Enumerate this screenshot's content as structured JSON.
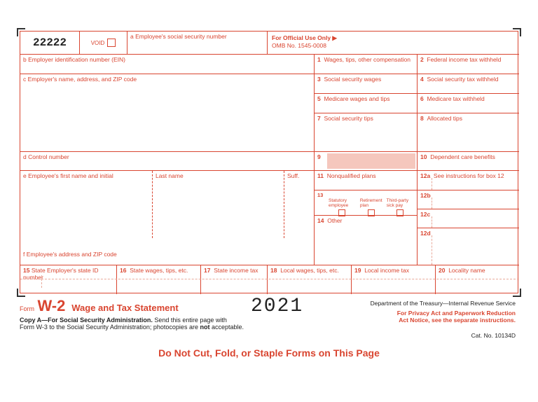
{
  "form_number": "22222",
  "void_label": "VOID",
  "box_a": "a  Employee's social security number",
  "omb_title": "For Official Use Only ▶",
  "omb_number": "OMB No. 1545-0008",
  "box_b": "b  Employer identification number (EIN)",
  "box_c": "c  Employer's name, address, and ZIP code",
  "box_d": "d  Control number",
  "box_e": "e  Employee's first name and initial",
  "box_e_last": "Last name",
  "box_e_suff": "Suff.",
  "box_f": "f  Employee's address and ZIP code",
  "boxes": {
    "1": "Wages, tips, other compensation",
    "2": "Federal income tax withheld",
    "3": "Social security wages",
    "4": "Social security tax withheld",
    "5": "Medicare wages and tips",
    "6": "Medicare tax withheld",
    "7": "Social security tips",
    "8": "Allocated tips",
    "9": "",
    "10": "Dependent care benefits",
    "11": "Nonqualified plans",
    "12a": "See instructions for box 12",
    "12b": "",
    "12c": "",
    "12d": "",
    "13_statutory": "Statutory employee",
    "13_retirement": "Retirement plan",
    "13_thirdparty": "Third-party sick pay",
    "14": "Other",
    "15": "State   Employer's state ID number",
    "16": "State wages, tips, etc.",
    "17": "State income tax",
    "18": "Local wages, tips, etc.",
    "19": "Local income tax",
    "20": "Locality name"
  },
  "footer": {
    "form_word": "Form",
    "w2": "W-2",
    "title": "Wage and Tax Statement",
    "year": "2021",
    "dept": "Department of the Treasury—Internal Revenue Service",
    "privacy1": "For Privacy Act and Paperwork Reduction",
    "privacy2": "Act Notice, see the separate instructions.",
    "copy_a_bold": "Copy A—For Social Security Administration.",
    "copy_a_rest": " Send this entire page with",
    "copy_a_line2a": "Form W-3 to the Social Security Administration; photocopies are ",
    "copy_a_not": "not",
    "copy_a_line2b": " acceptable.",
    "cat_no": "Cat. No. 10134D",
    "do_not": "Do Not Cut, Fold, or Staple Forms on This Page"
  }
}
